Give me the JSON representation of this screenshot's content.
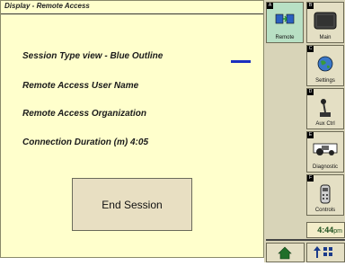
{
  "panel": {
    "title": "Display - Remote Access",
    "session_type": "Session Type  view - Blue Outline",
    "user_name": "Remote Access User Name",
    "organization": "Remote Access Organization",
    "connection_duration": "Connection Duration (m)  4:05",
    "end_session_label": "End Session"
  },
  "dock": {
    "tiles": [
      {
        "key": "A",
        "label": "Remote",
        "icon": "remote-icon",
        "selected": true
      },
      {
        "key": "B",
        "label": "Main",
        "icon": "monitor-icon"
      },
      {
        "key": "C",
        "label": "Settings",
        "icon": "globe-icon"
      },
      {
        "key": "D",
        "label": "Aux Ctrl",
        "icon": "joystick-icon"
      },
      {
        "key": "E",
        "label": "Diagnostic",
        "icon": "tractor-icon"
      },
      {
        "key": "F",
        "label": "Controls",
        "icon": "controller-icon"
      }
    ],
    "time_value": "4:44",
    "time_suffix": "pm"
  },
  "colors": {
    "panel_bg": "#ffffcc",
    "accent_blue": "#1a2fbf",
    "dock_bg": "#d8d4b8"
  }
}
